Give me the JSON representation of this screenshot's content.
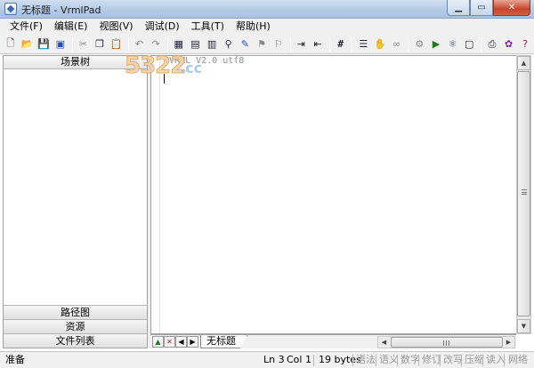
{
  "window": {
    "title": "无标题 - VrmlPad"
  },
  "menu": [
    "文件(F)",
    "编辑(E)",
    "视图(V)",
    "调试(D)",
    "工具(T)",
    "帮助(H)"
  ],
  "left_panel": {
    "header": "场景树",
    "bottom_buttons": [
      "路径图",
      "资源",
      "文件列表"
    ]
  },
  "editor": {
    "lines": [
      "#VRML V2.0 utf8"
    ],
    "tab": "无标题"
  },
  "watermark": {
    "main": "5322",
    "suffix": ".cc"
  },
  "status": {
    "ready": "准备",
    "ln": "Ln 3",
    "col": "Col 1",
    "bytes": "19 bytes",
    "indicators": [
      "语法",
      "语义",
      "数字",
      "修订",
      "改写",
      "压缩",
      "读入",
      "网络"
    ]
  }
}
